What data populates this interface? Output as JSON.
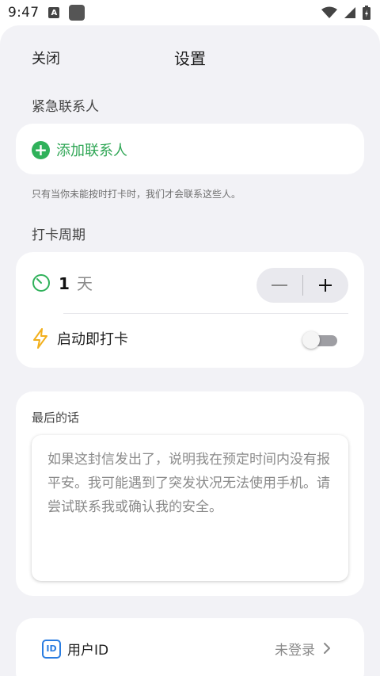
{
  "status_bar": {
    "time": "9:47",
    "app_indicator": "A",
    "icons": [
      "notification-box-icon",
      "wifi-icon",
      "signal-icon",
      "battery-icon"
    ]
  },
  "header": {
    "close_label": "关闭",
    "title": "设置"
  },
  "emergency": {
    "section_label": "紧急联系人",
    "add_label": "添加联系人",
    "hint": "只有当你未能按时打卡时，我们才会联系这些人。"
  },
  "checkin": {
    "section_label": "打卡周期",
    "period_value": "1",
    "period_unit": "天",
    "minus_label": "—",
    "plus_label": "+",
    "launch_label": "启动即打卡",
    "launch_enabled": false
  },
  "last_words": {
    "label": "最后的话",
    "placeholder": "如果这封信发出了，说明我在预定时间内没有报平安。我可能遇到了突发状况无法使用手机。请尝试联系我或确认我的安全。"
  },
  "account": {
    "user_label": "用户ID",
    "status": "未登录",
    "icon_text": "ID"
  },
  "colors": {
    "accent_green": "#2fb15a",
    "bolt_yellow": "#f2b01e",
    "id_blue": "#2a7de1",
    "sheet_bg": "#f2f2f6"
  }
}
